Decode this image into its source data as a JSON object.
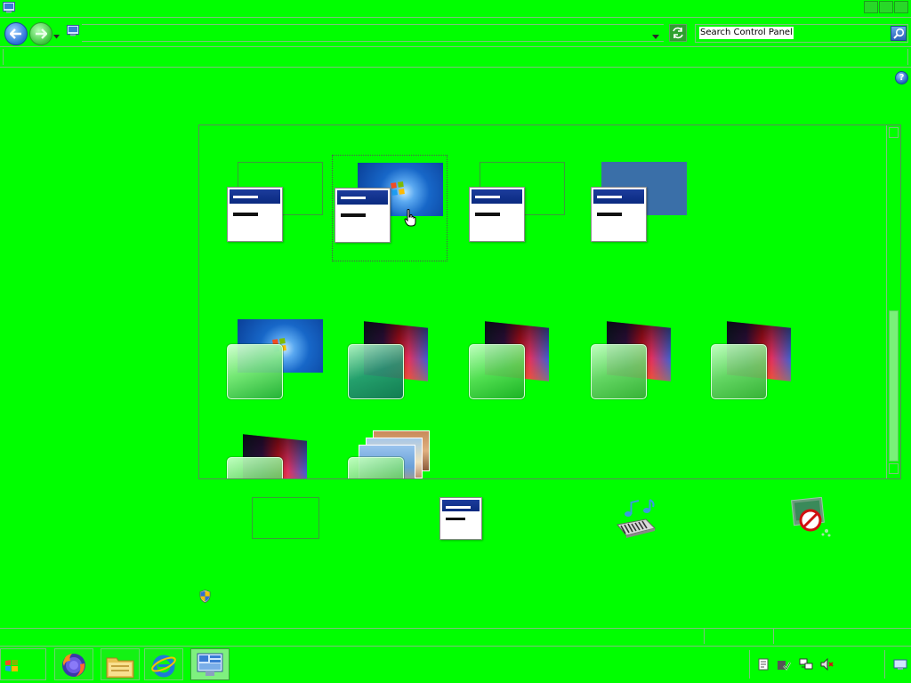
{
  "window": {
    "title_icon": "control-panel-icon",
    "controls": [
      "minimize-button",
      "maximize-button",
      "close-button"
    ]
  },
  "navigation": {
    "back_icon": "back-arrow-icon",
    "forward_icon": "forward-arrow-icon",
    "recent_icon": "chevron-down-icon",
    "address_icon": "control-panel-icon",
    "refresh_icon": "refresh-icon",
    "search_placeholder": "Search Control Panel",
    "search_icon": "search-icon"
  },
  "help_icon": "help-icon",
  "themes": {
    "row1": [
      {
        "background": "none",
        "style": "basic"
      },
      {
        "background": "windows-7",
        "style": "basic",
        "selected": true
      },
      {
        "background": "none",
        "style": "basic"
      },
      {
        "background": "solid-blue",
        "style": "basic"
      }
    ],
    "row2": [
      {
        "background": "windows-7",
        "style": "glass"
      },
      {
        "background": "rainbow",
        "style": "glass"
      },
      {
        "background": "rainbow",
        "style": "glass"
      },
      {
        "background": "rainbow",
        "style": "glass"
      },
      {
        "background": "rainbow",
        "style": "glass"
      }
    ],
    "row3": [
      {
        "background": "rainbow",
        "style": "glass"
      },
      {
        "background": "photo-stack",
        "style": "glass"
      }
    ]
  },
  "bottom_items": [
    {
      "icon": "desktop-background-icon"
    },
    {
      "icon": "window-color-icon"
    },
    {
      "icon": "sounds-icon"
    },
    {
      "icon": "screen-saver-icon"
    }
  ],
  "shield_icon": "uac-shield-icon",
  "taskbar": {
    "start_icon": "windows-start-icon",
    "apps": [
      "firefox-icon",
      "file-explorer-icon",
      "internet-explorer-icon",
      "control-panel-icon"
    ],
    "tray": [
      "notification-icon",
      "security-icon",
      "network-icon",
      "volume-muted-icon"
    ],
    "show_desktop_icon": "show-desktop-icon"
  }
}
